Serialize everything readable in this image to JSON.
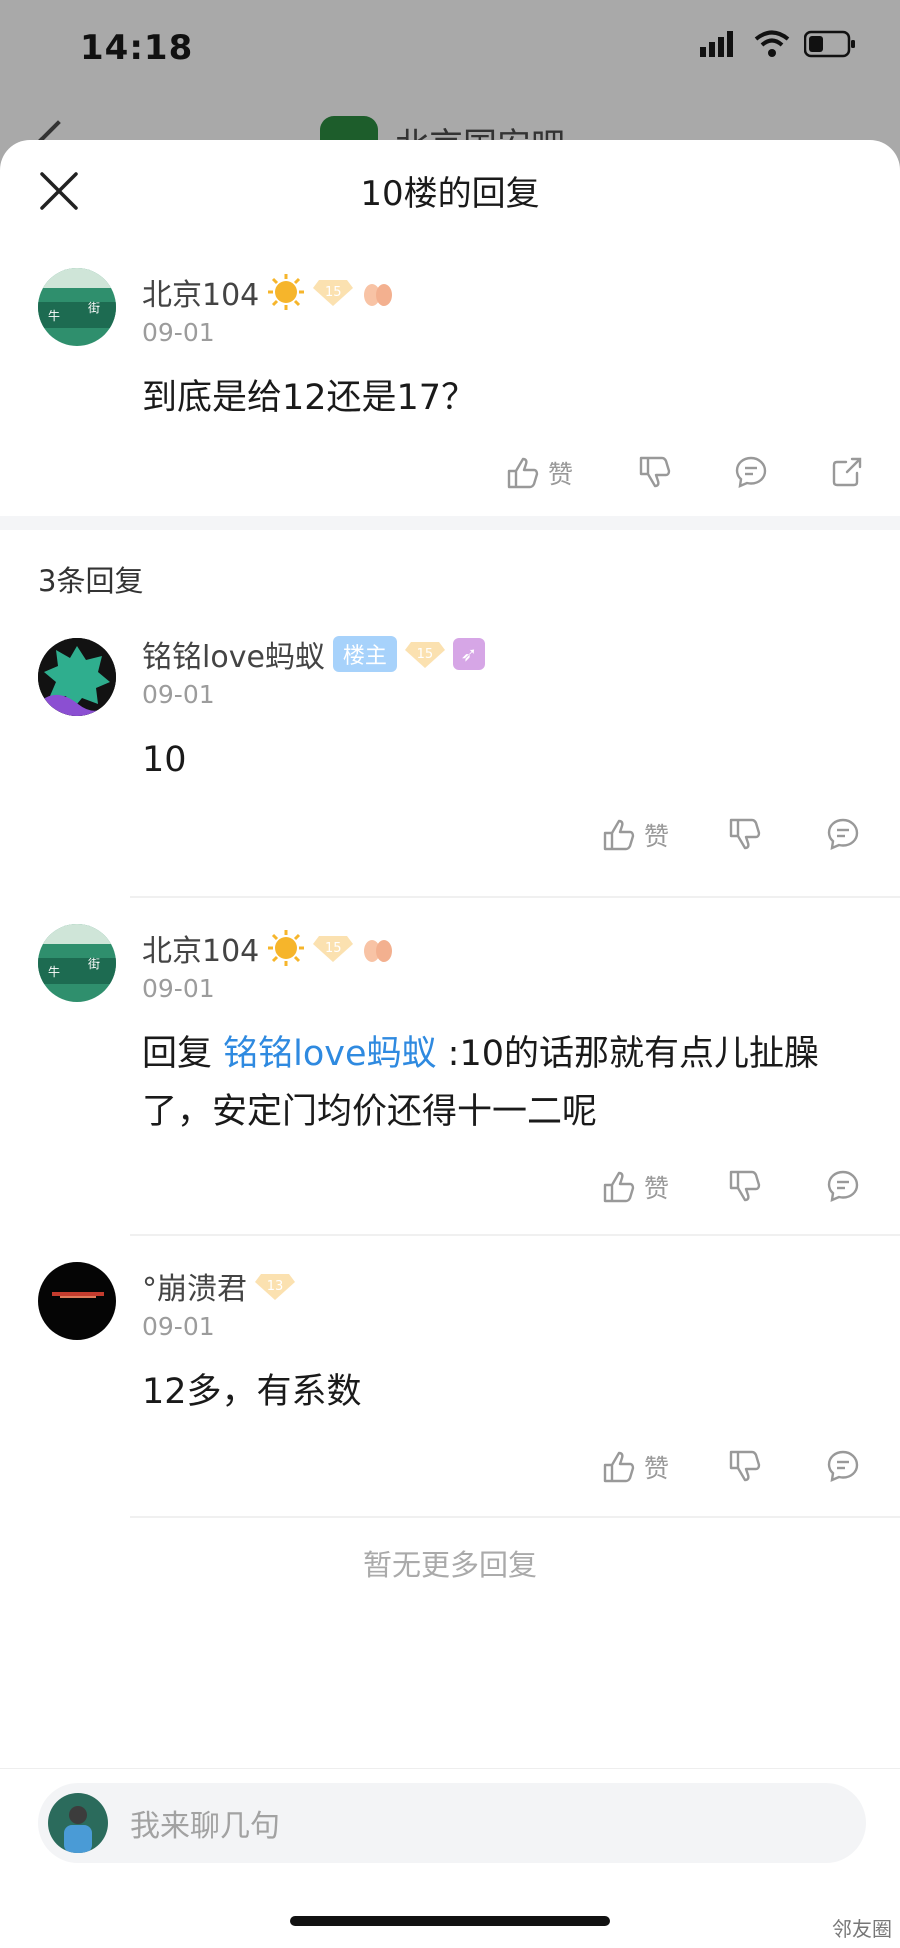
{
  "status": {
    "time": "14:18"
  },
  "background_page": {
    "title": "北京国安吧"
  },
  "sheet": {
    "title": "10楼的回复"
  },
  "main_comment": {
    "user": "北京104",
    "level": "15",
    "date": "09-01",
    "content": "到底是给12还是17？",
    "like_label": "赞"
  },
  "replies_header": "3条回复",
  "replies": [
    {
      "user": "铭铭love蚂蚁",
      "owner_badge": "楼主",
      "level": "15",
      "date": "09-01",
      "content": "10",
      "like_label": "赞"
    },
    {
      "user": "北京104",
      "level": "15",
      "date": "09-01",
      "reply_prefix": "回复 ",
      "reply_to": "铭铭love蚂蚁",
      "content": " :10的话那就有点儿扯臊了，安定门均价还得十一二呢",
      "like_label": "赞"
    },
    {
      "user": "°崩溃君",
      "level": "13",
      "date": "09-01",
      "content": "12多，有系数",
      "like_label": "赞"
    }
  ],
  "no_more": "暂无更多回复",
  "input": {
    "placeholder": "我来聊几句"
  },
  "watermark": "邻友圈"
}
